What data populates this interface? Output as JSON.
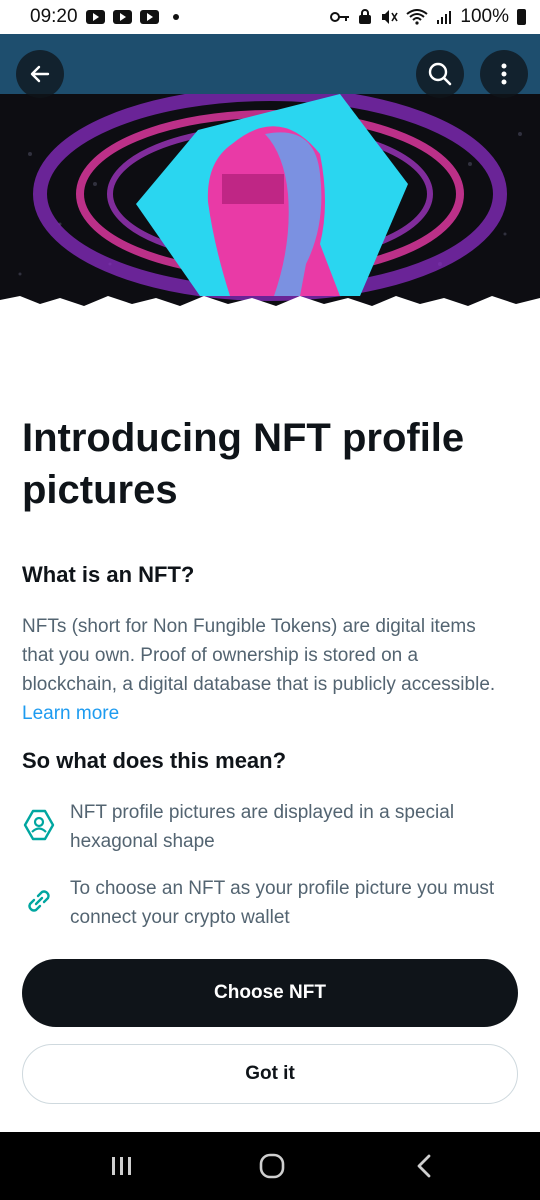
{
  "status_bar": {
    "time": "09:20",
    "battery": "100%",
    "icons": [
      "youtube-icon",
      "youtube-icon",
      "youtube-icon",
      "notification-dot",
      "key-icon",
      "lock-icon",
      "mute-icon",
      "wifi-icon",
      "signal-icon",
      "battery-icon"
    ]
  },
  "toolbar": {
    "back_icon": "arrow-left-icon",
    "search_icon": "search-icon",
    "more_icon": "more-vertical-icon"
  },
  "hero": {
    "image": "nft-hexagon-head-illustration",
    "colors": {
      "cyan": "#2ad6f0",
      "magenta": "#e93aa6",
      "purple": "#8a2cc4",
      "bg": "#0d0d12"
    }
  },
  "content": {
    "title": "Introducing NFT profile pictures",
    "section1_heading": "What is an NFT?",
    "section1_body": "NFTs (short for Non Fungible Tokens) are digital items that you own. Proof of ownership is stored on a blockchain, a digital database that is publicly accessible.",
    "learn_more": "Learn more",
    "section2_heading": "So what does this mean?",
    "features": [
      {
        "icon": "hexagon-profile-icon",
        "text": "NFT profile pictures are displayed in a special hexagonal shape"
      },
      {
        "icon": "link-icon",
        "text": "To choose an NFT as your profile picture you must connect your crypto wallet"
      }
    ]
  },
  "actions": {
    "primary": "Choose NFT",
    "secondary": "Got it"
  },
  "nav_bar": {
    "recent_icon": "recent-apps-icon",
    "home_icon": "home-icon",
    "back_icon": "back-icon"
  },
  "theme": {
    "accent": "#1d9bf0",
    "icon_accent": "#00a6a0",
    "text_primary": "#0f1419",
    "text_secondary": "#536471"
  }
}
